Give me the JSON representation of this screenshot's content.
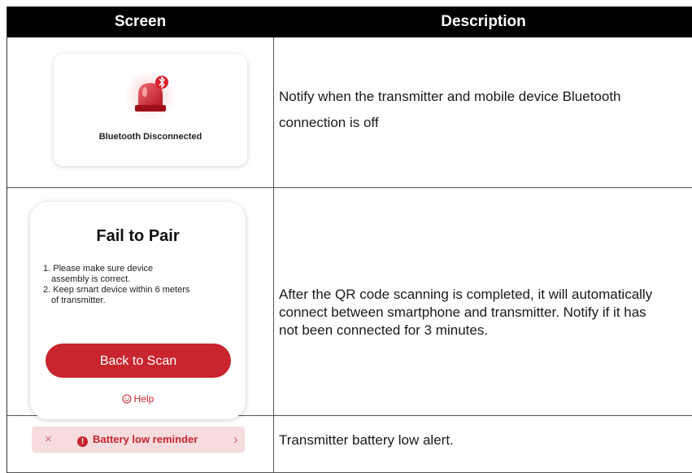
{
  "header": {
    "col_screen": "Screen",
    "col_description": "Description"
  },
  "rows": [
    {
      "screen": {
        "label": "Bluetooth Disconnected",
        "icon": "siren-bluetooth-icon"
      },
      "description_lines": [
        "Notify when the transmitter and mobile device Bluetooth",
        "connection is off"
      ]
    },
    {
      "screen": {
        "title": "Fail to Pair",
        "items": [
          "1. Please make sure device",
          "assembly is correct.",
          "2. Keep smart device within 6 meters",
          "of transmitter."
        ],
        "button_label": "Back to Scan",
        "help_label": "Help"
      },
      "description_lines": [
        "After the QR code scanning is completed, it will automatically",
        "connect between smartphone and transmitter. Notify if it has",
        "not been connected for 3 minutes."
      ]
    },
    {
      "screen": {
        "label": "Battery low reminder",
        "close_icon": "×",
        "chevron_icon": "›",
        "alert_icon": "!"
      },
      "description_lines": [
        "Transmitter battery low alert."
      ]
    }
  ],
  "colors": {
    "accent": "#c8252f",
    "banner_bg": "#f6dcdf",
    "header_bg": "#000000"
  }
}
